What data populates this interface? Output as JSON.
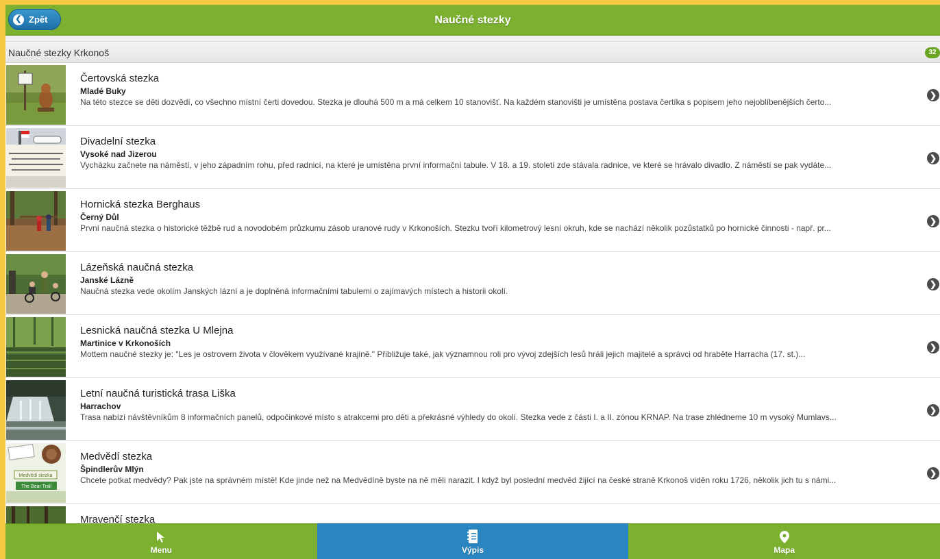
{
  "header": {
    "back_label": "Zpět",
    "back_icon": "chevron-left-icon",
    "title": "Naučné stezky"
  },
  "section": {
    "title": "Naučné stezky Krkonoš",
    "count": "32"
  },
  "items": [
    {
      "title": "Čertovská stezka",
      "location": "Mladé Buky",
      "description": "Na této stezce se děti dozvědí, co všechno místní čerti dovedou. Stezka je dlouhá 500 m a má celkem 10 stanovišť. Na každém stanovišti je umístěna postava čertíka s popisem jeho nejoblíbenějších čerto..."
    },
    {
      "title": "Divadelní stezka",
      "location": "Vysoké nad Jizerou",
      "description": "Vycházku začnete na náměstí, v jeho západním rohu, před radnicí, na které je umístěna první informační tabule. V 18. a 19. století zde stávala radnice, ve které se hrávalo divadlo. Z náměstí se pak vydáte..."
    },
    {
      "title": "Hornická stezka Berghaus",
      "location": "Černý Důl",
      "description": "První naučná stezka o historické těžbě rud a novodobém průzkumu zásob uranové rudy v Krkonoších. Stezku tvoří kilometrový lesní okruh, kde se nachází několik pozůstatků po hornické činnosti - např. pr..."
    },
    {
      "title": "Lázeňská naučná stezka",
      "location": "Janské Lázně",
      "description": "Naučná stezka vede okolím Janských lázní a je doplněná informačními tabulemi o zajímavých místech a historii okolí."
    },
    {
      "title": "Lesnická naučná stezka U Mlejna",
      "location": "Martinice v Krkonoších",
      "description": "Mottem naučné stezky je: \"Les je ostrovem života v člověkem využívané krajině.\" Přibližuje také, jak významnou roli pro vývoj zdejších lesů hráli jejich majitelé a správci od hraběte Harracha (17. st.)..."
    },
    {
      "title": "Letní naučná turistická trasa Liška",
      "location": "Harrachov",
      "description": "Trasa nabízí návštěvníkům 8 informačních panelů, odpočinkové místo s atrakcemi pro děti a překrásné výhledy do okolí. Stezka vede z části I. a II. zónou KRNAP. Na trase zhlédneme 10 m vysoký Mumlavs..."
    },
    {
      "title": "Medvědí stezka",
      "location": "Špindlerův Mlýn",
      "description": "Chcete potkat medvědy? Pak jste na správném místě! Kde jinde než na Medvědíně byste na ně měli narazit. I když byl poslední medvěd žijící na české straně Krkonoš viděn roku 1726, několik jich tu s námi..."
    },
    {
      "title": "Mravenčí stezka",
      "location": "",
      "description": ""
    }
  ],
  "thumb_texts": {
    "bear_panel": "Medvědí stezka",
    "bear_trail": "The Bear Trail"
  },
  "chevron_icon": "chevron-right-icon",
  "nav": [
    {
      "label": "Menu",
      "icon": "cursor-arrow-icon"
    },
    {
      "label": "Výpis",
      "icon": "list-notebook-icon",
      "active": true
    },
    {
      "label": "Mapa",
      "icon": "map-pin-icon"
    }
  ],
  "colors": {
    "header_green": "#7cb130",
    "active_blue": "#2a86c0",
    "badge_green": "#6aa521",
    "frame_yellow": "#f5c842"
  }
}
